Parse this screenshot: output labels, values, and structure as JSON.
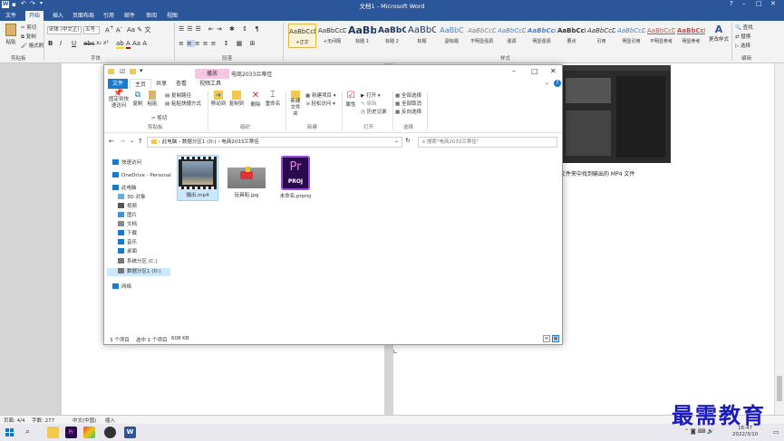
{
  "word": {
    "title": "文档1 - Microsoft Word",
    "tabs": [
      "文件",
      "开始",
      "插入",
      "页面布局",
      "引用",
      "邮件",
      "审阅",
      "视图"
    ],
    "active_tab": "开始",
    "clipboard": {
      "paste": "粘贴",
      "cut": "剪切",
      "copy": "复制",
      "format_painter": "格式刷",
      "group": "剪贴板"
    },
    "font": {
      "name": "宋体 (中文正)",
      "size": "五号",
      "group": "字体"
    },
    "paragraph_group": "段落",
    "styles": [
      {
        "sample": "AaBbCcDd",
        "name": "+正文"
      },
      {
        "sample": "AaBbCcDd",
        "name": "+无间隔"
      },
      {
        "sample": "AaBb",
        "name": "标题 1"
      },
      {
        "sample": "AaBbC",
        "name": "标题 2"
      },
      {
        "sample": "AaBbC",
        "name": "标题"
      },
      {
        "sample": "AaBbC",
        "name": "副标题"
      },
      {
        "sample": "AaBbCcDd",
        "name": "不明显强调"
      },
      {
        "sample": "AaBbCcDd",
        "name": "强调"
      },
      {
        "sample": "AaBbCcDd",
        "name": "明显强调"
      },
      {
        "sample": "AaBbCcDd",
        "name": "要点"
      },
      {
        "sample": "AaBbCcDd",
        "name": "引用"
      },
      {
        "sample": "AaBbCcDd",
        "name": "明显引用"
      },
      {
        "sample": "AaBbCcDd",
        "name": "不明显参考"
      },
      {
        "sample": "AaBbCcDd",
        "name": "明显参考"
      }
    ],
    "styles_group": "样式",
    "change_styles": "更改样式",
    "editing": {
      "find": "查找",
      "replace": "替换",
      "select": "选择",
      "group": "编辑"
    },
    "doc_text": "文件夹中找到输出的 MP4 文件",
    "status": {
      "page": "页面: 4/4",
      "words": "字数: 277",
      "lang": "中文(中国)",
      "insert": "插入"
    }
  },
  "explorer": {
    "context_tab": "播放",
    "title": "电商2033兰蒂佳",
    "tabs": [
      "文件",
      "主页",
      "共享",
      "查看",
      "视频工具"
    ],
    "ribbon": {
      "pin": "固定到快速访问",
      "copy": "复制",
      "paste": "粘贴",
      "copy_path": "复制路径",
      "paste_shortcut": "粘贴快捷方式",
      "cut": "剪切",
      "clipboard": "剪贴板",
      "move_to": "移动到",
      "copy_to": "复制到",
      "delete": "删除",
      "rename": "重命名",
      "organize": "组织",
      "new_folder": "新建文件夹",
      "new_item": "新建项目",
      "easy_access": "轻松访问",
      "new": "新建",
      "properties": "属性",
      "open": "打开",
      "edit": "编辑",
      "history": "历史记录",
      "open_group": "打开",
      "select_all": "全部选择",
      "select_none": "全部取消",
      "invert": "反向选择",
      "select": "选择"
    },
    "breadcrumb": [
      "此电脑",
      "数据分区1 (D:)",
      "电商2033兰蒂佳"
    ],
    "search_placeholder": "搜索\"电商2033兰蒂佳\"",
    "nav": [
      {
        "label": "快速访问",
        "icon": "star-icon"
      },
      {
        "label": "OneDrive - Personal",
        "icon": "cloud-icon"
      },
      {
        "label": "此电脑",
        "icon": "computer-icon"
      },
      {
        "label": "3D 对象",
        "icon": "cube-icon"
      },
      {
        "label": "视频",
        "icon": "video-icon"
      },
      {
        "label": "图片",
        "icon": "picture-icon"
      },
      {
        "label": "文档",
        "icon": "document-icon"
      },
      {
        "label": "下载",
        "icon": "download-icon"
      },
      {
        "label": "音乐",
        "icon": "music-icon"
      },
      {
        "label": "桌面",
        "icon": "desktop-icon"
      },
      {
        "label": "系统分区 (C:)",
        "icon": "drive-icon"
      },
      {
        "label": "数据分区1 (D:)",
        "icon": "drive-icon"
      },
      {
        "label": "网络",
        "icon": "network-icon"
      }
    ],
    "files": [
      {
        "name": "输出.mp4"
      },
      {
        "name": "玩具船.jpg"
      },
      {
        "name": "未命名.prproj",
        "icon_text": "Pr",
        "icon_sub": "PROJ"
      }
    ],
    "status": {
      "count": "3 个项目",
      "selected": "选中 1 个项目",
      "size": "608 KB"
    }
  },
  "taskbar": {
    "time": "16:47",
    "date": "2022/3/10"
  },
  "watermark": "最需教育",
  "colors": {
    "word_blue": "#2b579a",
    "explorer_blue": "#1979ca",
    "context_pink": "#f5c6e4",
    "premiere": "#2a0a4a",
    "premiere_text": "#e77cff"
  }
}
